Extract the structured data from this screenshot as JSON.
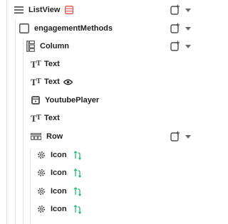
{
  "tree": {
    "nodes": [
      {
        "id": "listview",
        "label": "ListView",
        "type": "ListView"
      },
      {
        "id": "engagement",
        "label": "engagementMethods",
        "type": "Container"
      },
      {
        "id": "column",
        "label": "Column",
        "type": "Column"
      },
      {
        "id": "text1",
        "label": "Text",
        "type": "Text"
      },
      {
        "id": "text2",
        "label": "Text",
        "type": "Text",
        "hidden_indicator": "eye-icon"
      },
      {
        "id": "youtube",
        "label": "YoutubePlayer",
        "type": "YoutubePlayer"
      },
      {
        "id": "text3",
        "label": "Text",
        "type": "Text"
      },
      {
        "id": "row",
        "label": "Row",
        "type": "Row"
      },
      {
        "id": "icon1",
        "label": "Icon",
        "type": "Icon"
      },
      {
        "id": "icon2",
        "label": "Icon",
        "type": "Icon"
      },
      {
        "id": "icon3",
        "label": "Icon",
        "type": "Icon"
      },
      {
        "id": "icon4",
        "label": "Icon",
        "type": "Icon"
      }
    ]
  },
  "colors": {
    "text": "#1f1f1f",
    "icon_gray": "#5a5a5a",
    "listview_accent": "#e2574c",
    "swap_green": "#2bb673",
    "guide_line": "#e3e3e3"
  },
  "icons": {
    "add_widget": "add-widget-icon",
    "caret": "chevron-down-icon",
    "visibility": "eye-icon",
    "swap": "swap-icon"
  }
}
